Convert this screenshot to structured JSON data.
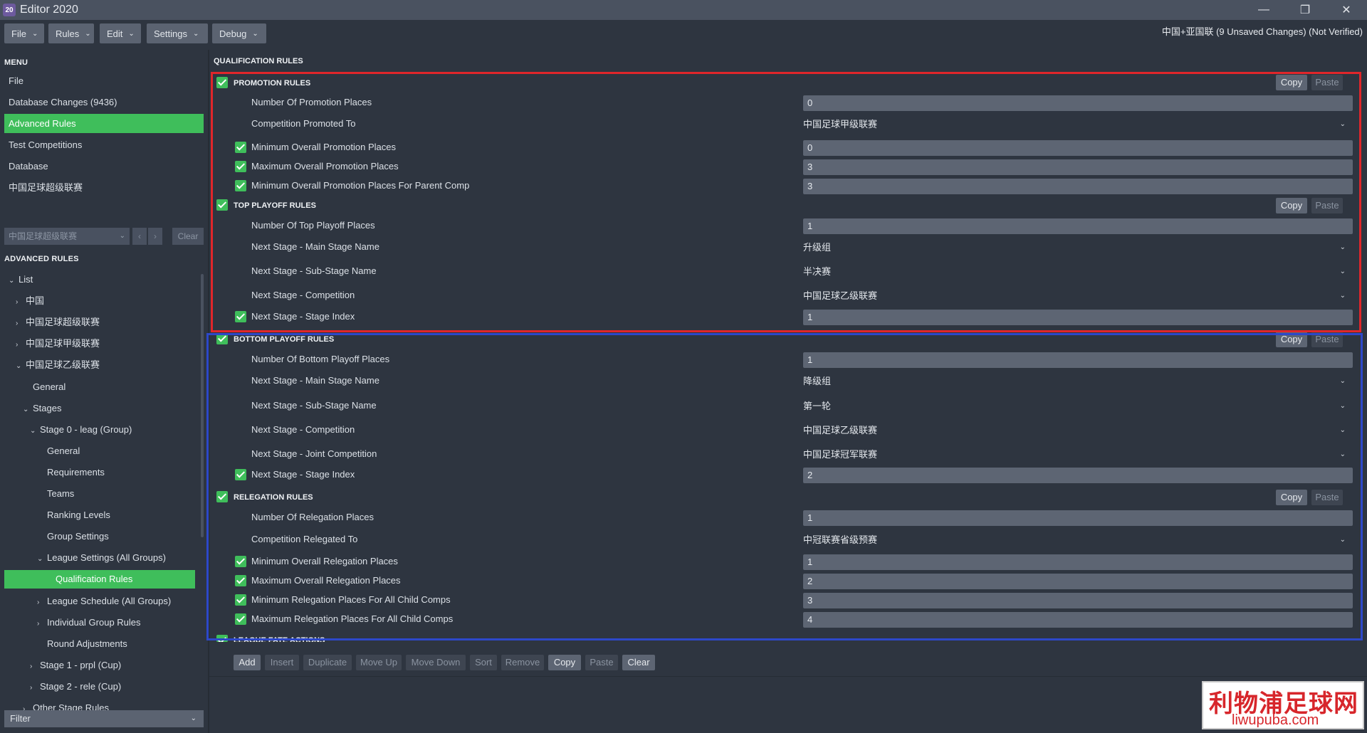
{
  "window": {
    "title": "Editor 2020",
    "icon_text": "20",
    "controls": [
      "minimize-icon",
      "restore-icon",
      "close-icon"
    ]
  },
  "menubar": {
    "items": [
      "File",
      "Rules",
      "Edit",
      "Settings",
      "Debug"
    ],
    "status": "中国+亚国联 (9 Unsaved Changes) (Not Verified)"
  },
  "sidebar": {
    "menu_head": "MENU",
    "menu_items": [
      "File",
      "Database Changes (9436)",
      "Advanced Rules",
      "Test Competitions",
      "Database",
      "中国足球超级联赛"
    ],
    "active_menu": 2,
    "competition_select": "中国足球超级联赛",
    "clear_label": "Clear",
    "advanced_head": "ADVANCED RULES",
    "tree": [
      {
        "label": "List",
        "indent": 0,
        "tw": "⌄"
      },
      {
        "label": "中国",
        "indent": 1,
        "tw": "›"
      },
      {
        "label": "中国足球超级联赛",
        "indent": 1,
        "tw": "›"
      },
      {
        "label": "中国足球甲级联赛",
        "indent": 1,
        "tw": "›"
      },
      {
        "label": "中国足球乙级联赛",
        "indent": 1,
        "tw": "⌄"
      },
      {
        "label": "General",
        "indent": 2,
        "tw": ""
      },
      {
        "label": "Stages",
        "indent": 2,
        "tw": "⌄"
      },
      {
        "label": "Stage 0 - leag (Group)",
        "indent": 3,
        "tw": "⌄"
      },
      {
        "label": "General",
        "indent": 4,
        "tw": ""
      },
      {
        "label": "Requirements",
        "indent": 4,
        "tw": ""
      },
      {
        "label": "Teams",
        "indent": 4,
        "tw": ""
      },
      {
        "label": "Ranking Levels",
        "indent": 4,
        "tw": ""
      },
      {
        "label": "Group Settings",
        "indent": 4,
        "tw": ""
      },
      {
        "label": "League Settings (All Groups)",
        "indent": 4,
        "tw": "⌄"
      },
      {
        "label": "Qualification Rules",
        "indent": 5,
        "tw": "",
        "active": true
      },
      {
        "label": "League Schedule (All Groups)",
        "indent": 4,
        "tw": "›"
      },
      {
        "label": "Individual Group Rules",
        "indent": 4,
        "tw": "›"
      },
      {
        "label": "Round Adjustments",
        "indent": 4,
        "tw": ""
      },
      {
        "label": "Stage 1 - prpl (Cup)",
        "indent": 3,
        "tw": "›"
      },
      {
        "label": "Stage 2 - rele (Cup)",
        "indent": 3,
        "tw": "›"
      },
      {
        "label": "Other Stage Rules",
        "indent": 2,
        "tw": "›"
      }
    ],
    "filter_label": "Filter"
  },
  "main": {
    "title": "QUALIFICATION RULES",
    "copy_label": "Copy",
    "paste_label": "Paste",
    "groups": {
      "promotion": "PROMOTION RULES",
      "top_playoff": "TOP PLAYOFF RULES",
      "bottom_playoff": "BOTTOM PLAYOFF RULES",
      "relegation": "RELEGATION RULES",
      "league_fate": "LEAGUE FATE ACTIONS"
    },
    "rows": {
      "num_promotion": {
        "label": "Number Of Promotion Places",
        "value": "0"
      },
      "comp_promoted": {
        "label": "Competition Promoted To",
        "value": "中国足球甲级联赛"
      },
      "min_overall_promo": {
        "label": "Minimum Overall Promotion Places",
        "value": "0"
      },
      "max_overall_promo": {
        "label": "Maximum Overall Promotion Places",
        "value": "3"
      },
      "min_promo_parent": {
        "label": "Minimum Overall Promotion Places For Parent Comp",
        "value": "3"
      },
      "num_top_playoff": {
        "label": "Number Of Top Playoff Places",
        "value": "1"
      },
      "top_main_stage": {
        "label": "Next Stage - Main Stage Name",
        "value": "升级组"
      },
      "top_sub_stage": {
        "label": "Next Stage - Sub-Stage Name",
        "value": "半决赛"
      },
      "top_competition": {
        "label": "Next Stage - Competition",
        "value": "中国足球乙级联赛"
      },
      "top_stage_index": {
        "label": "Next Stage - Stage Index",
        "value": "1"
      },
      "num_bottom_playoff": {
        "label": "Number Of Bottom Playoff Places",
        "value": "1"
      },
      "bot_main_stage": {
        "label": "Next Stage - Main Stage Name",
        "value": "降级组"
      },
      "bot_sub_stage": {
        "label": "Next Stage - Sub-Stage Name",
        "value": "第一轮"
      },
      "bot_competition": {
        "label": "Next Stage - Competition",
        "value": "中国足球乙级联赛"
      },
      "bot_joint_comp": {
        "label": "Next Stage - Joint Competition",
        "value": "中国足球冠军联赛"
      },
      "bot_stage_index": {
        "label": "Next Stage - Stage Index",
        "value": "2"
      },
      "num_relegation": {
        "label": "Number Of Relegation Places",
        "value": "1"
      },
      "comp_relegated": {
        "label": "Competition Relegated To",
        "value": "中冠联赛省级预赛"
      },
      "min_overall_rel": {
        "label": "Minimum Overall Relegation Places",
        "value": "1"
      },
      "max_overall_rel": {
        "label": "Maximum Overall Relegation Places",
        "value": "2"
      },
      "min_rel_child": {
        "label": "Minimum Relegation Places For All Child Comps",
        "value": "3"
      },
      "max_rel_child": {
        "label": "Maximum Relegation Places For All Child Comps",
        "value": "4"
      }
    },
    "toolbar": [
      "Add",
      "Insert",
      "Duplicate",
      "Move Up",
      "Move Down",
      "Sort",
      "Remove",
      "Copy",
      "Paste",
      "Clear"
    ]
  },
  "watermark": {
    "cn": "利物浦足球网",
    "en": "liwupuba.com"
  },
  "colors": {
    "accent_green": "#3fbe5b",
    "highlight_red": "#e0262a",
    "highlight_blue": "#2d48c9"
  }
}
